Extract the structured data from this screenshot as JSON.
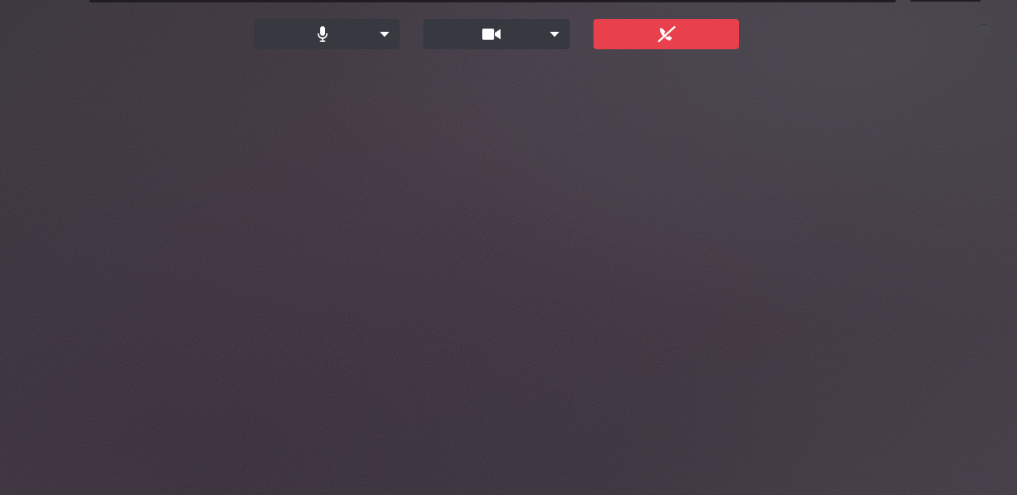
{
  "colors": {
    "background": "#332b34",
    "control_bg": "#36393f",
    "hangup_bg": "#e8404c",
    "icon": "#ffffff"
  },
  "controls": {
    "microphone": {
      "icon": "microphone-icon",
      "dropdown_icon": "caret-down-icon"
    },
    "camera": {
      "icon": "video-camera-icon",
      "dropdown_icon": "caret-down-icon"
    },
    "hangup": {
      "icon": "phone-hangup-icon"
    }
  },
  "corner": {
    "icon": "user-avatar-icon"
  }
}
